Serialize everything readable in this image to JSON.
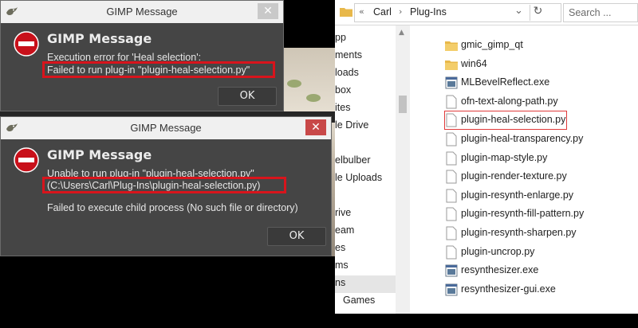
{
  "dialog1": {
    "window_title": "GIMP Message",
    "heading": "GIMP Message",
    "line1": "Execution error for 'Heal selection':",
    "line2": "Failed to run plug-in \"plugin-heal-selection.py\"",
    "ok_label": "OK",
    "close_glyph": "✕"
  },
  "dialog2": {
    "window_title": "GIMP Message",
    "heading": "GIMP Message",
    "line1": "Unable to run plug-in \"plugin-heal-selection.py\"",
    "line2": "(C:\\Users\\Carl\\Plug-Ins\\plugin-heal-selection.py)",
    "line3": "Failed to execute child process (No such file or directory)",
    "ok_label": "OK",
    "close_glyph": "✕"
  },
  "explorer": {
    "breadcrumb": {
      "back": "«",
      "carl": "Carl",
      "sep": "›",
      "plugins": "Plug-Ins",
      "dropdown": "⌄",
      "refresh": "↻"
    },
    "search_placeholder": "Search ...",
    "nav_items": [
      "pp",
      "ments",
      "loads",
      "box",
      "ites",
      "le Drive",
      "",
      "elbulber",
      "le Uploads",
      "",
      "",
      "",
      "rive",
      "eam",
      "es",
      "ms",
      "ns",
      "Games"
    ],
    "files": [
      {
        "name": "gmic_gimp_qt",
        "icon": "folder-icon"
      },
      {
        "name": "win64",
        "icon": "folder-icon"
      },
      {
        "name": "MLBevelReflect.exe",
        "icon": "exe-icon"
      },
      {
        "name": "ofn-text-along-path.py",
        "icon": "file-icon"
      },
      {
        "name": "plugin-heal-selection.py",
        "icon": "file-icon"
      },
      {
        "name": "plugin-heal-transparency.py",
        "icon": "file-icon"
      },
      {
        "name": "plugin-map-style.py",
        "icon": "file-icon"
      },
      {
        "name": "plugin-render-texture.py",
        "icon": "file-icon"
      },
      {
        "name": "plugin-resynth-enlarge.py",
        "icon": "file-icon"
      },
      {
        "name": "plugin-resynth-fill-pattern.py",
        "icon": "file-icon"
      },
      {
        "name": "plugin-resynth-sharpen.py",
        "icon": "file-icon"
      },
      {
        "name": "plugin-uncrop.py",
        "icon": "file-icon"
      },
      {
        "name": "resynthesizer.exe",
        "icon": "exe-icon"
      },
      {
        "name": "resynthesizer-gui.exe",
        "icon": "exe-icon"
      }
    ]
  },
  "colors": {
    "highlight": "#d8141c",
    "dialog_bg": "#454545",
    "folder": "#e8b84a"
  }
}
